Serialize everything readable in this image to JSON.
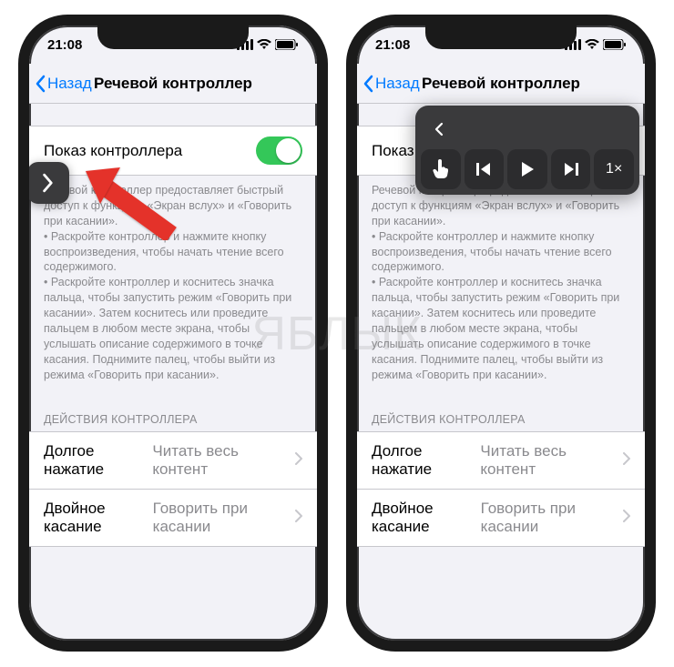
{
  "status": {
    "time": "21:08"
  },
  "nav": {
    "back": "Назад",
    "title": "Речевой контроллер"
  },
  "main": {
    "show_controller_label": "Показ контроллера",
    "description": "Речевой контроллер предоставляет быстрый доступ к функциям «Экран вслух» и «Говорить при касании».\n • Раскройте контроллер и нажмите кнопку воспроизведения, чтобы начать чтение всего содержимого.\n • Раскройте контроллер и коснитесь значка пальца, чтобы запустить режим «Говорить при касании». Затем коснитесь или проведите пальцем в любом месте экрана, чтобы услышать описание содержимого в точке касания. Поднимите палец, чтобы выйти из режима «Говорить при касании».",
    "actions_header": "ДЕЙСТВИЯ КОНТРОЛЛЕРА",
    "long_press_label": "Долгое нажатие",
    "long_press_value": "Читать весь контент",
    "double_tap_label": "Двойное касание",
    "double_tap_value": "Говорить при касании"
  },
  "controller": {
    "rate": "1×"
  },
  "watermark": "ЯБЛЫК"
}
